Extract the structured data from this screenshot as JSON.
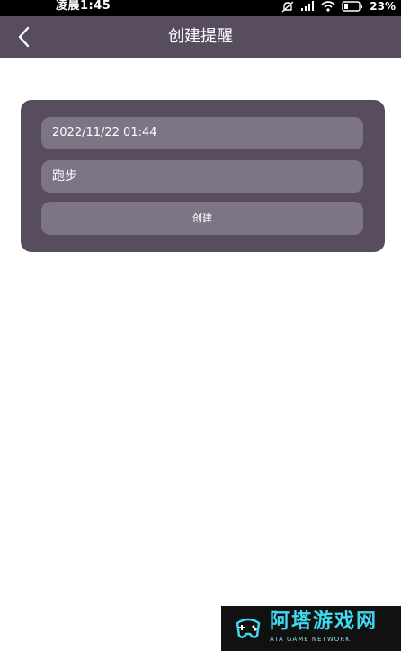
{
  "status_bar": {
    "time": "凌晨1:45",
    "battery": "23%"
  },
  "header": {
    "title": "创建提醒",
    "back_icon": "chevron-left-icon"
  },
  "form": {
    "datetime_value": "2022/11/22 01:44",
    "content_value": "跑步",
    "create_label": "创建"
  },
  "colors": {
    "header_bg": "#574d5f",
    "card_bg": "#574d5f",
    "field_bg": "#7d7485",
    "watermark_accent": "#3fd9f0"
  },
  "watermark": {
    "brand": "阿塔游戏网",
    "subtitle": "ATA GAME NETWORK"
  }
}
